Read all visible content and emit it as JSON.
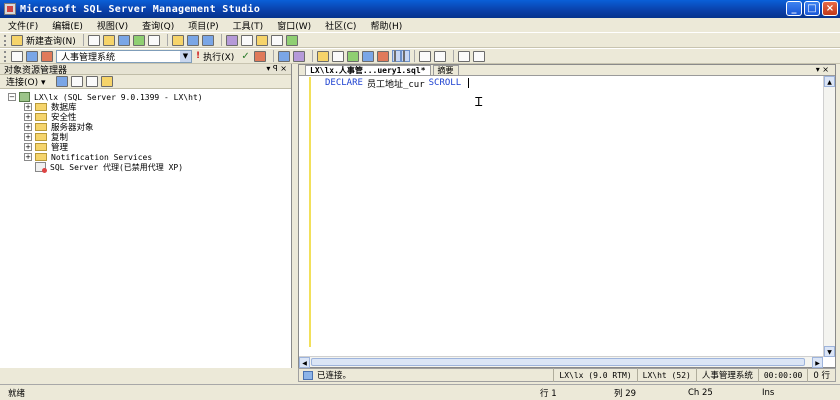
{
  "window": {
    "title": "Microsoft SQL Server Management Studio",
    "buttons": {
      "minimize": "_",
      "maximize": "□",
      "close": "×"
    }
  },
  "menu": [
    "文件(F)",
    "编辑(E)",
    "视图(V)",
    "查询(Q)",
    "项目(P)",
    "工具(T)",
    "窗口(W)",
    "社区(C)",
    "帮助(H)"
  ],
  "toolbar1": {
    "new_query": "新建查询(N)"
  },
  "toolbar2": {
    "database": "人事管理系统",
    "execute": "执行(X)",
    "checkmark": "✓"
  },
  "object_explorer": {
    "title": "对象资源管理器",
    "pin": "▾ ꟼ ×",
    "connect": "连接(O) ▾",
    "server": "LX\\lx (SQL Server 9.0.1399 - LX\\ht)",
    "nodes": [
      "数据库",
      "安全性",
      "服务器对象",
      "复制",
      "管理",
      "Notification Services"
    ],
    "agent": "SQL Server 代理(已禁用代理 XP)"
  },
  "editor": {
    "tab_active": "LX\\lx.人事管...uery1.sql*",
    "tab_inactive": "摘要",
    "controls": "▾ ×",
    "code": {
      "keyword": "DECLARE",
      "identifier": "员工地址_cur",
      "keyword2": "SCROLL"
    }
  },
  "query_status": {
    "connected": "已连接。",
    "server": "LX\\lx (9.0 RTM)",
    "user": "LX\\ht (52)",
    "database": "人事管理系统",
    "time": "00:00:00",
    "rows": "0 行"
  },
  "status_bar": {
    "ready": "就绪",
    "line": "行 1",
    "column": "列 29",
    "char": "Ch 25",
    "mode": "Ins"
  }
}
